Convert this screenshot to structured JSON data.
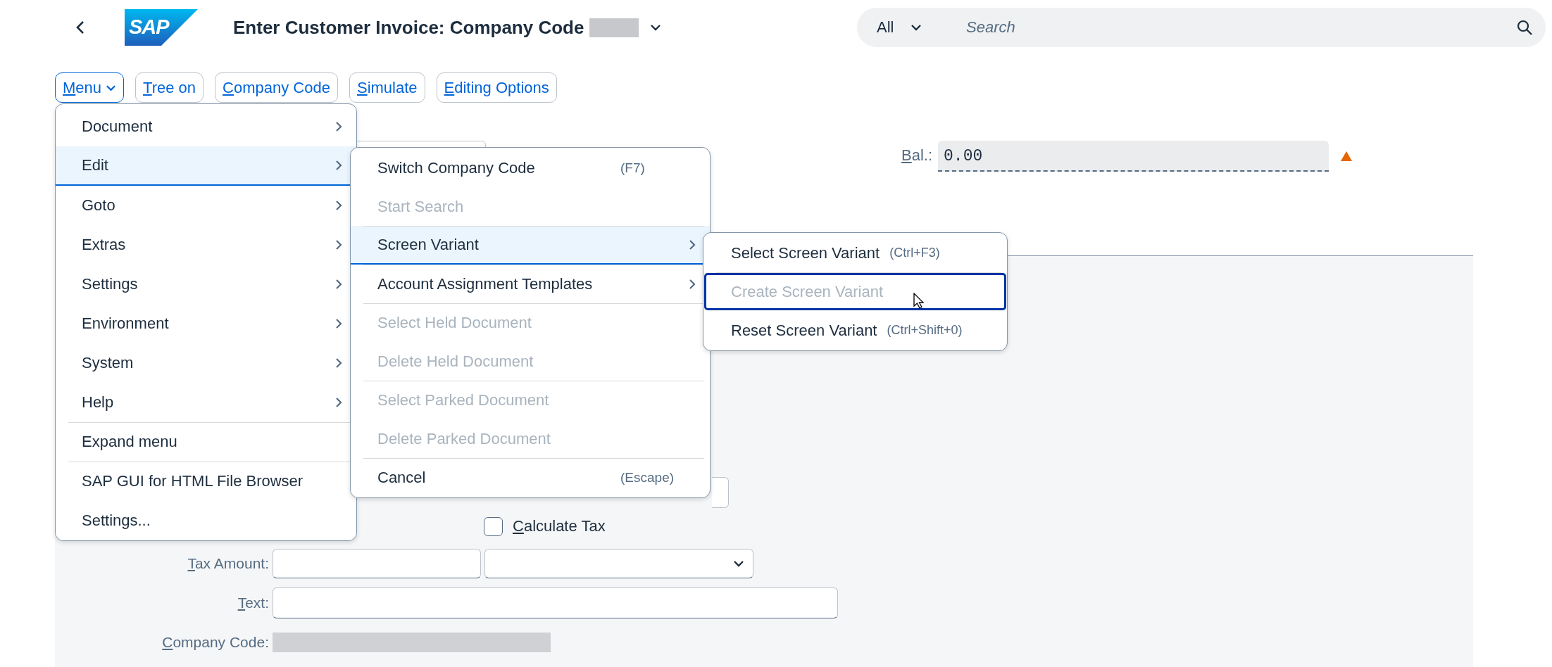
{
  "header": {
    "logo": "SAP",
    "title": "Enter Customer Invoice: Company Code",
    "search": {
      "scope": "All",
      "placeholder": "Search"
    }
  },
  "toolbar": [
    {
      "label": "Menu",
      "selected": true,
      "kind": "dropdown"
    },
    {
      "label": "Tree on",
      "selected": false,
      "kind": "button"
    },
    {
      "label": "Company Code",
      "selected": false,
      "kind": "button"
    },
    {
      "label": "Simulate",
      "selected": false,
      "kind": "button"
    },
    {
      "label": "Editing Options",
      "selected": false,
      "kind": "button"
    }
  ],
  "balance": {
    "label": "Bal.:",
    "value": "0.00",
    "warning": true
  },
  "form": {
    "calculate_tax": {
      "label": "Calculate Tax",
      "checked": false
    },
    "fields": [
      {
        "label": "Tax Amount:",
        "kind": "amount"
      },
      {
        "label": "Text:",
        "kind": "text"
      },
      {
        "label": "Company Code:",
        "kind": "redacted"
      }
    ]
  },
  "menu": [
    {
      "label": "Document",
      "submenu": true,
      "selected": false,
      "separator_before": false
    },
    {
      "label": "Edit",
      "submenu": true,
      "selected": true,
      "separator_before": false
    },
    {
      "label": "Goto",
      "submenu": true,
      "selected": false,
      "separator_before": false
    },
    {
      "label": "Extras",
      "submenu": true,
      "selected": false,
      "separator_before": false
    },
    {
      "label": "Settings",
      "submenu": true,
      "selected": false,
      "separator_before": false
    },
    {
      "label": "Environment",
      "submenu": true,
      "selected": false,
      "separator_before": false
    },
    {
      "label": "System",
      "submenu": true,
      "selected": false,
      "separator_before": false
    },
    {
      "label": "Help",
      "submenu": true,
      "selected": false,
      "separator_before": false
    },
    {
      "label": "Expand menu",
      "submenu": false,
      "selected": false,
      "separator_before": true
    },
    {
      "label": "SAP GUI for HTML File Browser",
      "submenu": false,
      "selected": false,
      "separator_before": true
    },
    {
      "label": "Settings...",
      "submenu": false,
      "selected": false,
      "separator_before": false
    }
  ],
  "edit_menu": [
    {
      "label": "Switch Company Code",
      "shortcut": "(F7)",
      "submenu": false,
      "disabled": false,
      "selected": false,
      "separator_before": false
    },
    {
      "label": "Start Search",
      "submenu": false,
      "disabled": true,
      "selected": false,
      "separator_before": false
    },
    {
      "label": "Screen Variant",
      "submenu": true,
      "disabled": false,
      "selected": true,
      "separator_before": true
    },
    {
      "label": "Account Assignment Templates",
      "submenu": true,
      "disabled": false,
      "selected": false,
      "separator_before": true
    },
    {
      "label": "Select Held Document",
      "submenu": false,
      "disabled": true,
      "selected": false,
      "separator_before": true
    },
    {
      "label": "Delete Held Document",
      "submenu": false,
      "disabled": true,
      "selected": false,
      "separator_before": false
    },
    {
      "label": "Select Parked Document",
      "submenu": false,
      "disabled": true,
      "selected": false,
      "separator_before": true
    },
    {
      "label": "Delete Parked Document",
      "submenu": false,
      "disabled": true,
      "selected": false,
      "separator_before": false
    },
    {
      "label": "Cancel",
      "shortcut": "(Escape)",
      "submenu": false,
      "disabled": false,
      "selected": false,
      "separator_before": true
    }
  ],
  "screen_variant_menu": [
    {
      "label": "Select Screen Variant",
      "shortcut": "(Ctrl+F3)",
      "disabled": false,
      "focused": false,
      "separator_before": false
    },
    {
      "label": "Create Screen Variant",
      "disabled": true,
      "focused": true,
      "separator_before": true
    },
    {
      "label": "Reset Screen Variant",
      "shortcut": "(Ctrl+Shift+0)",
      "disabled": false,
      "focused": false,
      "separator_before": false
    }
  ]
}
